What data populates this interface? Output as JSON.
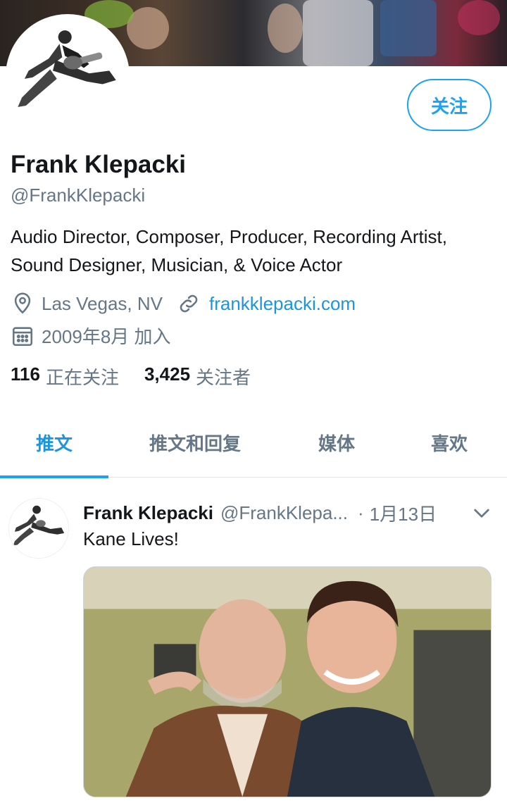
{
  "profile": {
    "name": "Frank Klepacki",
    "handle": "@FrankKlepacki",
    "bio": "Audio Director, Composer, Producer, Recording Artist, Sound Designer, Musician, & Voice Actor",
    "location": "Las Vegas, NV",
    "website": "frankklepacki.com",
    "joined": "2009年8月 加入",
    "follow_label": "关注",
    "following_count": "116",
    "following_label": "正在关注",
    "followers_count": "3,425",
    "followers_label": "关注者"
  },
  "tabs": [
    {
      "label": "推文",
      "active": true
    },
    {
      "label": "推文和回复",
      "active": false
    },
    {
      "label": "媒体",
      "active": false
    },
    {
      "label": "喜欢",
      "active": false
    }
  ],
  "tweet": {
    "name": "Frank Klepacki",
    "handle": "@FrankKlepa...",
    "separator": "·",
    "date": "1月13日",
    "text": "Kane Lives!"
  },
  "icons": {
    "location": "map-pin-icon",
    "link": "link-icon",
    "calendar": "calendar-icon",
    "chevron": "chevron-down-icon"
  },
  "colors": {
    "accent": "#1da1f2",
    "link": "#1b95e0",
    "secondary_text": "#657786",
    "primary_text": "#14171a"
  }
}
